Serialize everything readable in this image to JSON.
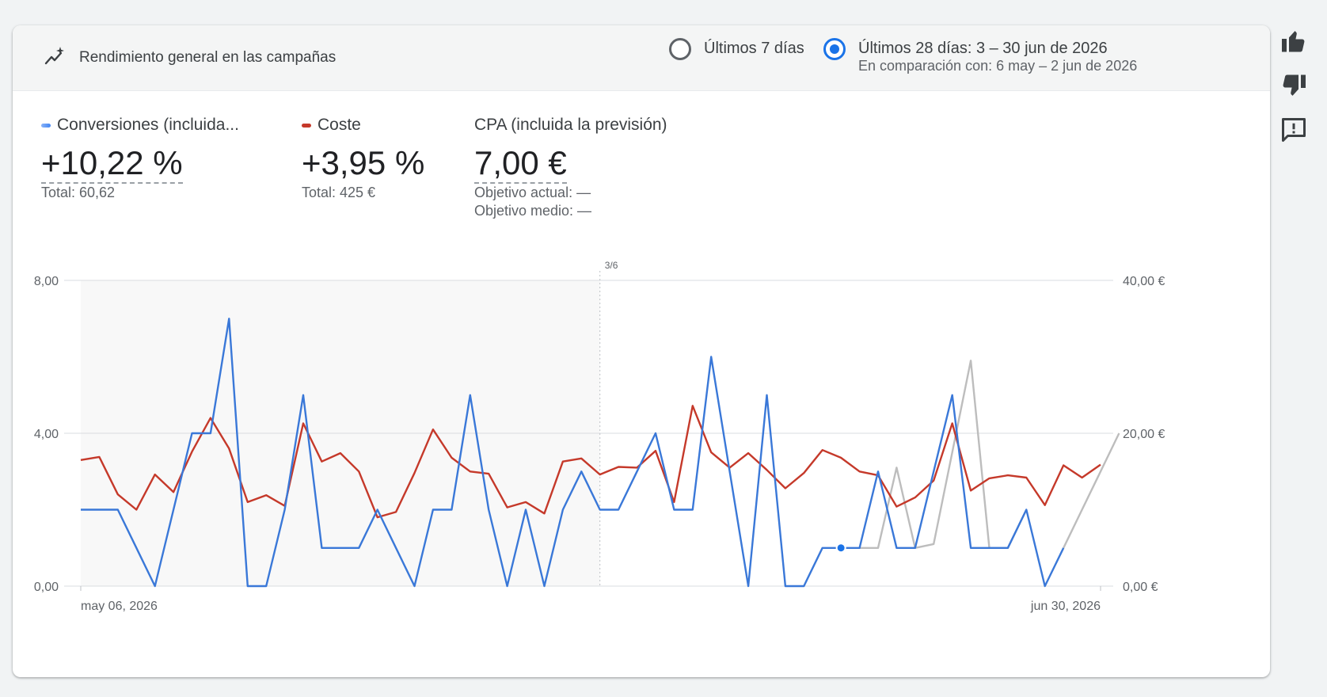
{
  "header": {
    "title": "Rendimiento general en las campañas",
    "range_7_label": "Últimos 7 días",
    "range_28_label": "Últimos 28 días: 3 – 30 jun de 2026",
    "range_28_compare": "En comparación con: 6 may – 2 jun de 2026",
    "selected_range": "28"
  },
  "metrics": [
    {
      "name": "Conversiones (incluida...",
      "value": "+10,22 %",
      "sub1": "Total: 60,62",
      "sub2": "",
      "color": "#4285f4"
    },
    {
      "name": "Coste",
      "value": "+3,95 %",
      "sub1": "Total: 425 €",
      "sub2": "",
      "color": "#c5392a"
    },
    {
      "name": "CPA (incluida la previsión)",
      "value": "7,00 €",
      "sub1": "Objetivo actual: —",
      "sub2": "Objetivo medio: —",
      "color": ""
    }
  ],
  "chart_data": {
    "type": "line",
    "x_start_label": "may 06, 2026",
    "x_end_label": "jun 30, 2026",
    "divider_label": "3/6",
    "y_left_ticks": [
      "0,00",
      "4,00",
      "8,00"
    ],
    "y_right_ticks": [
      "0,00 €",
      "20,00 €",
      "40,00 €"
    ],
    "y_left_range": [
      0,
      8
    ],
    "y_right_range": [
      0,
      40
    ],
    "divider_index": 28,
    "series": [
      {
        "axis": "left",
        "color": "#3a78d8",
        "values": [
          2,
          2,
          2,
          1,
          0,
          2,
          4,
          4,
          7,
          0,
          0,
          2,
          5,
          1,
          1,
          1,
          2,
          1,
          0,
          2,
          2,
          5,
          2,
          0,
          2,
          0,
          2,
          3,
          2,
          2,
          3,
          4,
          2,
          2,
          6,
          3,
          0,
          5,
          0,
          0,
          1,
          1,
          1,
          3,
          1,
          1,
          3,
          5,
          1,
          1,
          1,
          2,
          0,
          1,
          null,
          null
        ]
      },
      {
        "axis": "left",
        "color": "#bdbdbd",
        "values": [
          null,
          null,
          null,
          null,
          null,
          null,
          null,
          null,
          null,
          null,
          null,
          null,
          null,
          null,
          null,
          null,
          null,
          null,
          null,
          null,
          null,
          null,
          null,
          null,
          null,
          null,
          null,
          null,
          null,
          null,
          null,
          null,
          null,
          null,
          null,
          null,
          null,
          null,
          null,
          null,
          null,
          null,
          1,
          1,
          3.1,
          1,
          1.1,
          3.5,
          5.9,
          1,
          1,
          2,
          null,
          1,
          2,
          3,
          4
        ]
      },
      {
        "axis": "right",
        "color": "#c5392a",
        "values": [
          16.5,
          16.9,
          12,
          10,
          14.6,
          12.3,
          17.6,
          22,
          18,
          11,
          11.9,
          10.5,
          21.3,
          16.3,
          17.4,
          15,
          9,
          9.7,
          14.8,
          20.5,
          16.8,
          15,
          14.7,
          10.3,
          11,
          9.5,
          16.3,
          16.7,
          14.6,
          15.6,
          15.5,
          17.7,
          11,
          23.6,
          17.5,
          15.5,
          17.4,
          15.2,
          12.8,
          14.8,
          17.8,
          16.8,
          15,
          14.5,
          10.4,
          11.6,
          13.8,
          21.3,
          12.5,
          14.1,
          14.5,
          14.2,
          10.6,
          15.8,
          14.2,
          15.9
        ]
      }
    ],
    "highlight_point": {
      "series": 0,
      "index": 41
    }
  }
}
